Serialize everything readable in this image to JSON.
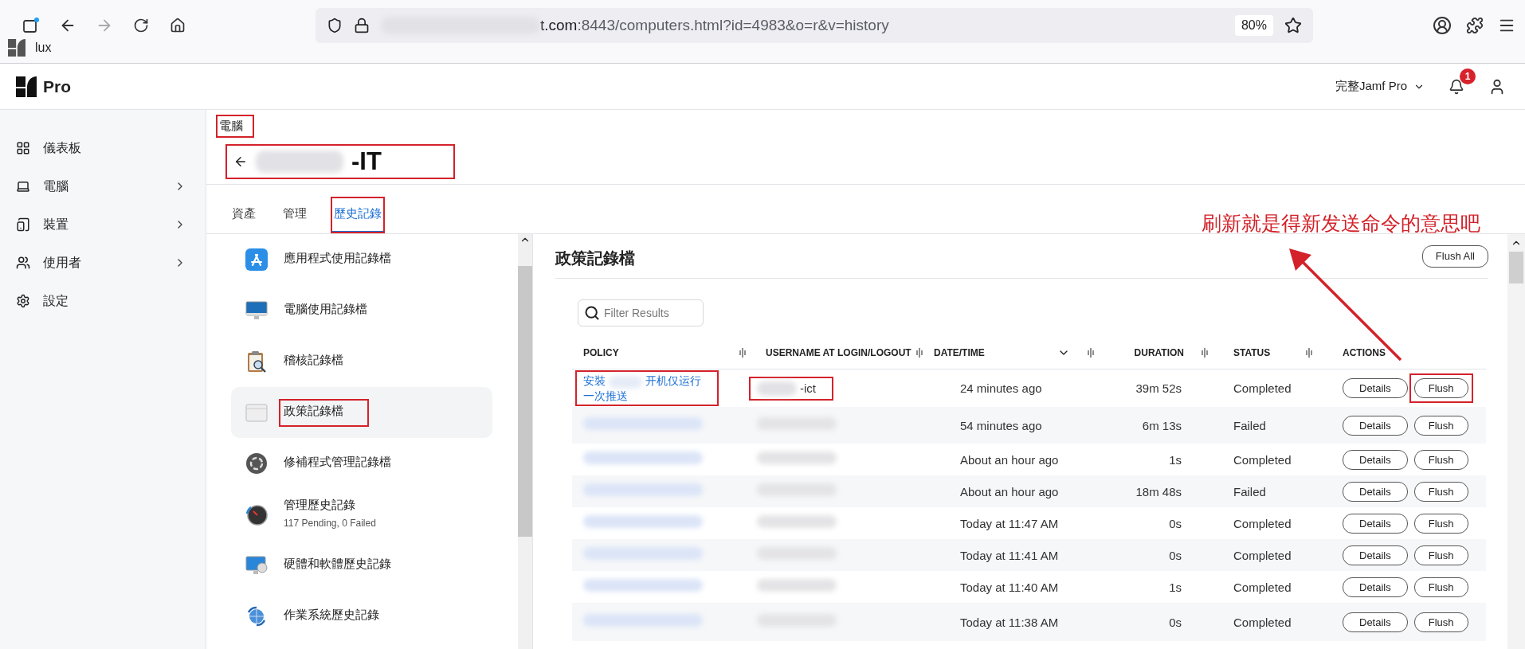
{
  "browser": {
    "url_host_tail": "t.com",
    "url_path": ":8443/computers.html?id=4983&o=r&v=history",
    "zoom": "80%",
    "bookmarks": [
      {
        "label": "lux"
      }
    ]
  },
  "header": {
    "logo": "Pro",
    "instance": "完整Jamf Pro",
    "notifications": "1"
  },
  "sidebar": {
    "items": [
      {
        "label": "儀表板",
        "expandable": false
      },
      {
        "label": "電腦",
        "expandable": true
      },
      {
        "label": "裝置",
        "expandable": true
      },
      {
        "label": "使用者",
        "expandable": true
      },
      {
        "label": "設定",
        "expandable": false
      }
    ]
  },
  "breadcrumb": {
    "label": "電腦",
    "boxed": true
  },
  "title": {
    "suffix": "-IT",
    "boxed": true
  },
  "tabs": [
    {
      "label": "資產",
      "selected": false,
      "boxed": false
    },
    {
      "label": "管理",
      "selected": false,
      "boxed": false
    },
    {
      "label": "歷史記錄",
      "selected": true,
      "boxed": true
    }
  ],
  "history_list": {
    "items": [
      {
        "label": "應用程式使用記錄檔",
        "selected": false,
        "boxed": false
      },
      {
        "label": "電腦使用記錄檔",
        "selected": false,
        "boxed": false
      },
      {
        "label": "稽核記錄檔",
        "selected": false,
        "boxed": false
      },
      {
        "label": "政策記錄檔",
        "selected": true,
        "boxed": true
      },
      {
        "label": "修補程式管理記錄檔",
        "selected": false,
        "boxed": false
      },
      {
        "label": "管理歷史記錄",
        "subtitle": "117 Pending, 0 Failed",
        "selected": false,
        "boxed": false
      },
      {
        "label": "硬體和軟體歷史記錄",
        "selected": false,
        "boxed": false
      },
      {
        "label": "作業系統歷史記錄",
        "selected": false,
        "boxed": false
      }
    ]
  },
  "panel": {
    "title": "政策記錄檔",
    "flush_all": "Flush All",
    "filter": {
      "placeholder": "Filter Results"
    },
    "columns": [
      {
        "label": "POLICY",
        "sorted": false
      },
      {
        "label": "USERNAME AT LOGIN/LOGOUT",
        "sorted": false
      },
      {
        "label": "DATE/TIME",
        "sorted": true
      },
      {
        "label": "DURATION",
        "sorted": false
      },
      {
        "label": "STATUS",
        "sorted": false
      },
      {
        "label": "ACTIONS",
        "sorted": false
      }
    ],
    "rows": [
      {
        "policy": [
          "安裝",
          "开机仅运行一次推送"
        ],
        "policy_boxed": true,
        "username": "-ict",
        "username_boxed": true,
        "datetime": "24 minutes ago",
        "duration": "39m 52s",
        "status": "Completed",
        "actions": [
          "Details",
          "Flush"
        ],
        "flush_boxed": true
      },
      {
        "datetime": "54 minutes ago",
        "duration": "6m 13s",
        "status": "Failed",
        "actions": [
          "Details",
          "Flush"
        ],
        "policy_boxed": false,
        "username_boxed": false,
        "flush_boxed": false
      },
      {
        "datetime": "About an hour ago",
        "duration": "1s",
        "status": "Completed",
        "actions": [
          "Details",
          "Flush"
        ],
        "policy_boxed": false,
        "username_boxed": false,
        "flush_boxed": false
      },
      {
        "datetime": "About an hour ago",
        "duration": "18m 48s",
        "status": "Failed",
        "actions": [
          "Details",
          "Flush"
        ],
        "policy_boxed": false,
        "username_boxed": false,
        "flush_boxed": false
      },
      {
        "datetime": "Today at 11:47 AM",
        "duration": "0s",
        "status": "Completed",
        "actions": [
          "Details",
          "Flush"
        ],
        "policy_boxed": false,
        "username_boxed": false,
        "flush_boxed": false
      },
      {
        "datetime": "Today at 11:41 AM",
        "duration": "0s",
        "status": "Completed",
        "actions": [
          "Details",
          "Flush"
        ],
        "policy_boxed": false,
        "username_boxed": false,
        "flush_boxed": false
      },
      {
        "datetime": "Today at 11:40 AM",
        "duration": "1s",
        "status": "Completed",
        "actions": [
          "Details",
          "Flush"
        ],
        "policy_boxed": false,
        "username_boxed": false,
        "flush_boxed": false
      },
      {
        "datetime": "Today at 11:38 AM",
        "duration": "0s",
        "status": "Completed",
        "actions": [
          "Details",
          "Flush"
        ],
        "policy_boxed": false,
        "username_boxed": false,
        "flush_boxed": false
      }
    ]
  },
  "annotation": {
    "text": "刷新就是得新发送命令的意思吧"
  }
}
